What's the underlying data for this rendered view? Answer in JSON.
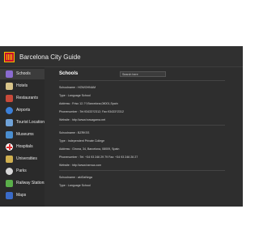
{
  "app": {
    "title": "Barcelona City Guide"
  },
  "sidebar": {
    "items": [
      {
        "label": "Schools",
        "icon": "school-icon",
        "color": "#8a6bd0"
      },
      {
        "label": "Hotels",
        "icon": "hotel-icon",
        "color": "#d8c48a"
      },
      {
        "label": "Restaurants",
        "icon": "restaurant-icon",
        "color": "#c84a3a"
      },
      {
        "label": "Airports",
        "icon": "airport-icon",
        "color": "#3b7fd8"
      },
      {
        "label": "Tourist Locations",
        "icon": "tourist-icon",
        "color": "#6fa2d8"
      },
      {
        "label": "Museums",
        "icon": "museum-icon",
        "color": "#4a8ed0"
      },
      {
        "label": "Hospitals",
        "icon": "hospital-icon",
        "color": "#e03030"
      },
      {
        "label": "Universities",
        "icon": "university-icon",
        "color": "#d0b050"
      },
      {
        "label": "Parks",
        "icon": "park-icon",
        "color": "#d8d8d8"
      },
      {
        "label": "Railway Stations",
        "icon": "railway-icon",
        "color": "#5aaf4a"
      },
      {
        "label": "Maps",
        "icon": "map-icon",
        "color": "#3a6bc8"
      }
    ]
  },
  "main": {
    "title": "Schools",
    "search_placeholder": "Search here",
    "schools": [
      {
        "name": "Schoolname : HOWOHNAM",
        "type": "Type : Language School",
        "address": "Address : Friso 12-??;Barcelona,08001,Spain",
        "phone": "Phonenumber : Tel:93433?2312; Fax:93433?2312",
        "website": "Website : http://www.howagama.net"
      },
      {
        "name": "Schoolname : BZRKSS",
        "type": "Type : Independent Private College",
        "address": "Address : Girona, 34, Barcelona, 08009, Spain",
        "phone": "Phonenumber : Tel: +34 93 246 29 79 Fax: +34 93 246 26 27",
        "website": "Website : http://www.bzrnca.com"
      },
      {
        "name": "Schoolname : akiGaNega",
        "type": "Type : Language School"
      }
    ]
  },
  "colors": {
    "background": "#2b2b2b",
    "active_item": "#3c3c3c",
    "text": "#e8e8e8"
  }
}
